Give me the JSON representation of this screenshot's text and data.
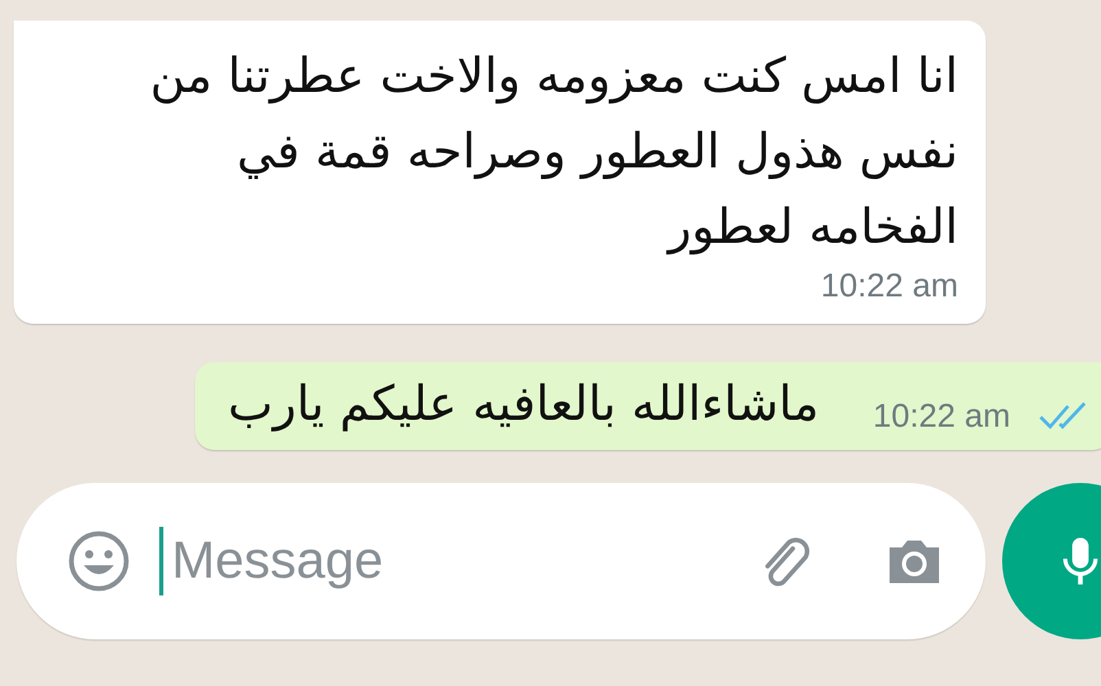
{
  "messages": [
    {
      "kind": "incoming",
      "text": "انا امس كنت معزومه والاخت عطرتنا من نفس هذول العطور وصراحه قمة في الفخامه لعطور",
      "time": "10:22 am"
    },
    {
      "kind": "outgoing",
      "text": "ماشاءالله بالعافيه عليكم يارب",
      "time": "10:22 am",
      "read": true
    }
  ],
  "composer": {
    "placeholder": "Message"
  }
}
